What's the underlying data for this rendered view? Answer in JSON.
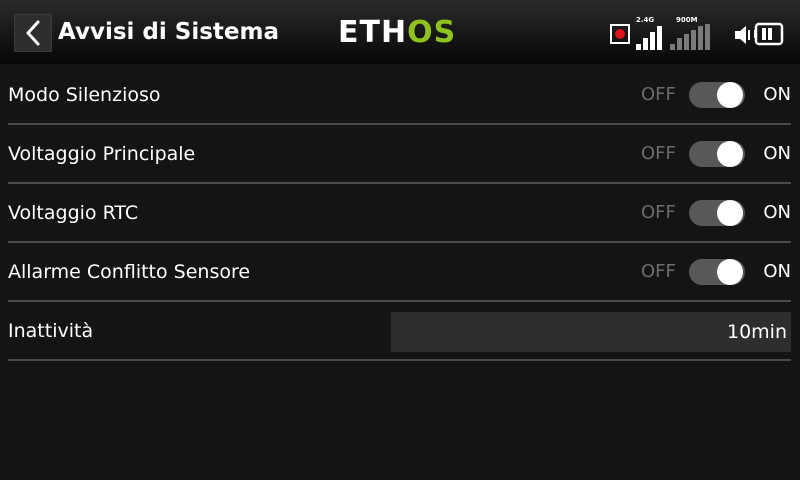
{
  "header": {
    "title": "Avvisi di Sistema",
    "logo_left": "ETH",
    "logo_right": "OS",
    "signal_1_label": "2.4G",
    "signal_2_label": "900M",
    "accent_color": "#8dc21f",
    "record_color": "#e0141e"
  },
  "settings": [
    {
      "label": "Modo Silenzioso",
      "off_label": "OFF",
      "on_label": "ON",
      "state": "ON"
    },
    {
      "label": "Voltaggio Principale",
      "off_label": "OFF",
      "on_label": "ON",
      "state": "ON"
    },
    {
      "label": "Voltaggio RTC",
      "off_label": "OFF",
      "on_label": "ON",
      "state": "ON"
    },
    {
      "label": "Allarme Conflitto Sensore",
      "off_label": "OFF",
      "on_label": "ON",
      "state": "ON"
    }
  ],
  "inactivity": {
    "label": "Inattività",
    "value": "10min"
  },
  "icons": {
    "back": "chevron-left-icon",
    "record": "record-icon",
    "signal_24": "signal-bars-icon",
    "signal_900": "signal-bars-icon",
    "volume": "speaker-muted-icon",
    "battery": "battery-icon"
  }
}
